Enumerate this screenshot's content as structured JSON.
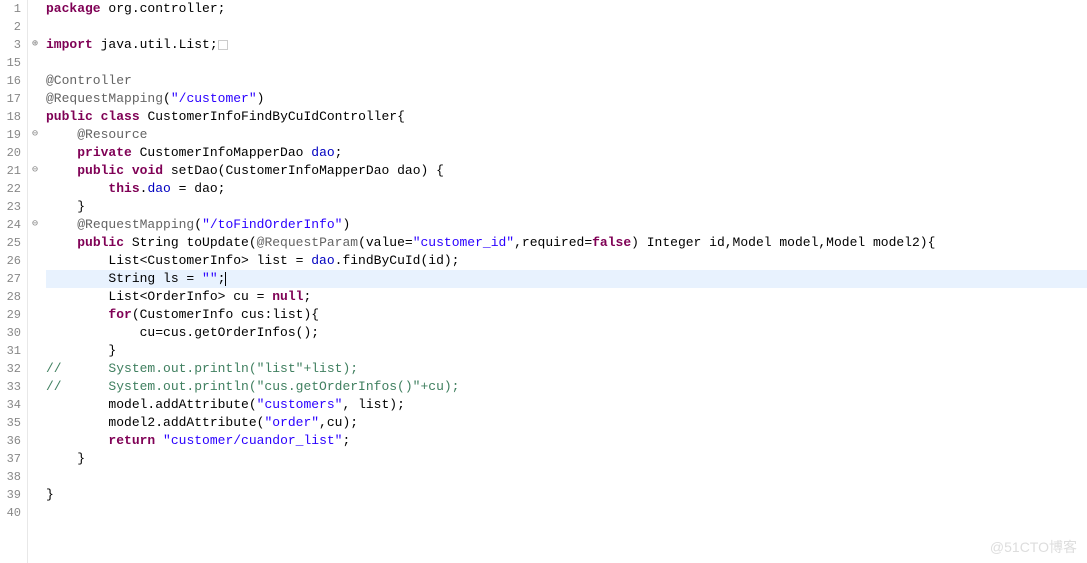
{
  "lineNumbers": [
    "1",
    "2",
    "3",
    "15",
    "16",
    "17",
    "18",
    "19",
    "20",
    "21",
    "22",
    "23",
    "24",
    "25",
    "26",
    "27",
    "28",
    "29",
    "30",
    "31",
    "32",
    "33",
    "34",
    "35",
    "36",
    "37",
    "38",
    "39",
    "40"
  ],
  "foldMarks": [
    "",
    "",
    "⊕",
    "",
    "",
    "",
    "",
    "⊖",
    "",
    "⊖",
    "",
    "",
    "⊖",
    "",
    "",
    "",
    "",
    "",
    "",
    "",
    "",
    "",
    "",
    "",
    "",
    "",
    "",
    "",
    ""
  ],
  "code": {
    "pkg_kw": "package",
    "pkg_name": " org.controller;",
    "import_kw": "import",
    "import_name": " java.util.List;",
    "ann_controller": "@Controller",
    "ann_reqmap": "@RequestMapping",
    "str_customer": "\"/customer\"",
    "public_kw": "public",
    "class_kw": "class",
    "class_name": " CustomerInfoFindByCuIdController{",
    "ann_resource": "@Resource",
    "private_kw": "private",
    "dao_decl": " CustomerInfoMapperDao ",
    "dao_field": "dao",
    "void_kw": "void",
    "setdao_sig": " setDao(CustomerInfoMapperDao dao) {",
    "this_kw": "this",
    "this_assign": ".",
    "this_assign2": " = dao;",
    "str_tofind": "\"/toFindOrderInfo\"",
    "toupdate_sig1": " String toUpdate(",
    "ann_reqparam": "@RequestParam",
    "reqparam_args1": "(value=",
    "str_custid": "\"customer_id\"",
    "reqparam_args2": ",required=",
    "false_kw": "false",
    "reqparam_args3": ") Integer id,Model model,Model model2){",
    "list_line": "        List<CustomerInfo> list = ",
    "list_line2": ".findByCuId(id);",
    "string_line1": "        String ls = ",
    "str_empty": "\"\"",
    "string_line2": ";",
    "orderinfo_line1": "        List<OrderInfo> cu = ",
    "null_kw": "null",
    "orderinfo_line2": ";",
    "for_kw": "for",
    "for_sig": "(CustomerInfo cus:list){",
    "cu_assign": "            cu=cus.getOrderInfos();",
    "brace_close": "        }",
    "comment1": "//      System.out.println(\"list\"+list);",
    "comment2": "//      System.out.println(\"cus.getOrderInfos()\"+cu);",
    "model_line1": "        model.addAttribute(",
    "str_customers": "\"customers\"",
    "model_line2": ", list);",
    "model2_line1": "        model2.addAttribute(",
    "str_order": "\"order\"",
    "model2_line2": ",cu);",
    "return_kw": "return",
    "str_return": "\"customer/cuandor_list\"",
    "return_end": ";",
    "method_close": "    }",
    "class_close": "}"
  },
  "watermark": "@51CTO博客"
}
